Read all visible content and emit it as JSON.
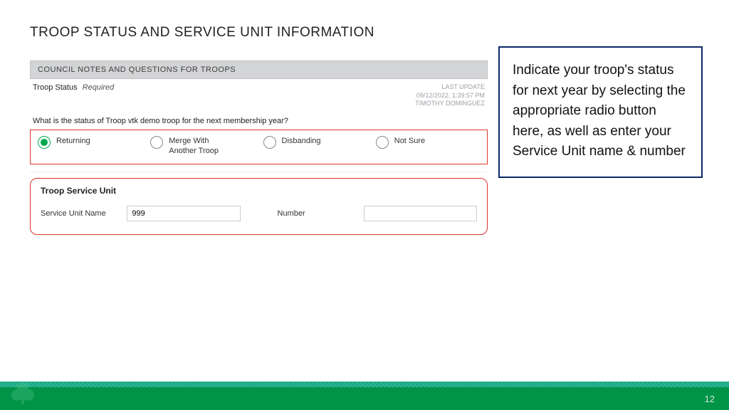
{
  "title": "TROOP STATUS AND SERVICE UNIT INFORMATION",
  "form": {
    "section_header": "COUNCIL NOTES AND QUESTIONS FOR TROOPS",
    "status_label": "Troop Status",
    "status_required": "Required",
    "last_update_label": "LAST UPDATE",
    "last_update_time": "09/12/2022, 1:39:57 PM",
    "last_update_by": "TIMOTHY DOMINGUEZ",
    "question": "What is the status of Troop vtk demo troop for the next membership year?",
    "options": [
      {
        "label": "Returning",
        "selected": true
      },
      {
        "label": "Merge With Another Troop",
        "selected": false
      },
      {
        "label": "Disbanding",
        "selected": false
      },
      {
        "label": "Not Sure",
        "selected": false
      }
    ],
    "service_unit_title": "Troop Service Unit",
    "su_name_label": "Service Unit Name",
    "su_name_value": "999",
    "su_number_label": "Number",
    "su_number_value": ""
  },
  "callout": "Indicate your troop's status for next year by selecting the appropriate radio button here, as well as enter your Service Unit name & number",
  "page_number": "12"
}
